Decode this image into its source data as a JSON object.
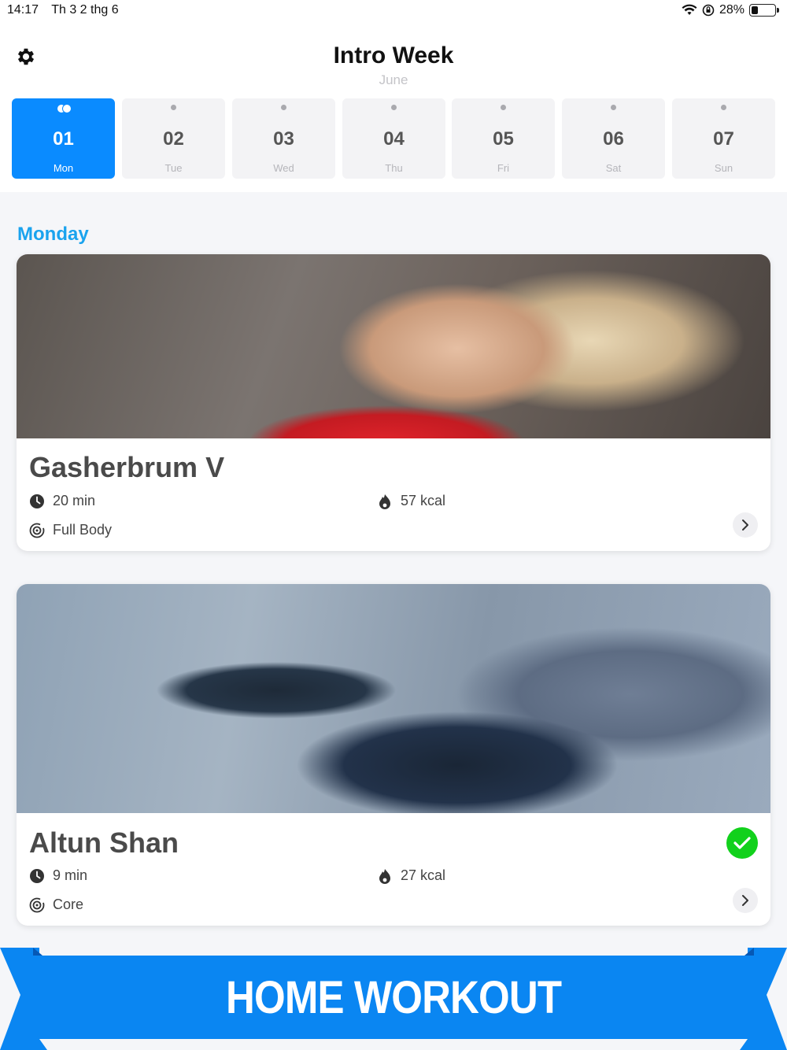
{
  "status_bar": {
    "time": "14:17",
    "date": "Th 3 2 thg 6",
    "battery": "28%",
    "battery_level": 0.28
  },
  "header": {
    "title": "Intro Week",
    "subtitle": "June"
  },
  "days": [
    {
      "num": "01",
      "name": "Mon",
      "active": true
    },
    {
      "num": "02",
      "name": "Tue",
      "active": false
    },
    {
      "num": "03",
      "name": "Wed",
      "active": false
    },
    {
      "num": "04",
      "name": "Thu",
      "active": false
    },
    {
      "num": "05",
      "name": "Fri",
      "active": false
    },
    {
      "num": "06",
      "name": "Sat",
      "active": false
    },
    {
      "num": "07",
      "name": "Sun",
      "active": false
    }
  ],
  "section": {
    "title": "Monday"
  },
  "workouts": [
    {
      "title": "Gasherbrum V",
      "duration": "20 min",
      "kcal": "57 kcal",
      "type": "Full Body",
      "completed": false
    },
    {
      "title": "Altun Shan",
      "duration": "9 min",
      "kcal": "27 kcal",
      "type": "Core",
      "completed": true
    }
  ],
  "banner": {
    "text": "HOME WORKOUT"
  },
  "colors": {
    "accent": "#0a8bff",
    "section_title": "#1aa3ee",
    "check": "#12d11c",
    "banner": "#0a86f2"
  },
  "icons": {
    "settings": "gear-icon",
    "duration": "clock-icon",
    "calories": "flame-icon",
    "type": "target-icon",
    "open": "chevron-right-icon",
    "done": "checkmark-icon"
  }
}
